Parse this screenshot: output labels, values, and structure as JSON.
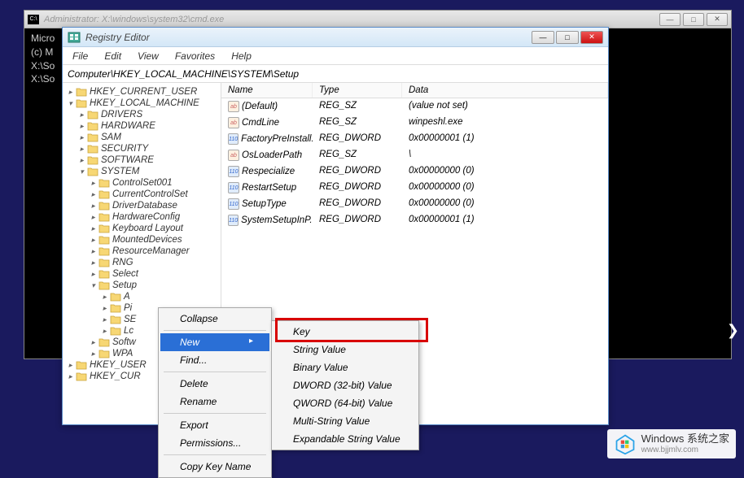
{
  "cmd": {
    "title": "Administrator: X:\\windows\\system32\\cmd.exe",
    "lines": [
      "Micro",
      "(c) M",
      "",
      "X:\\So",
      "",
      "X:\\So"
    ]
  },
  "regedit": {
    "title": "Registry Editor",
    "menus": [
      "File",
      "Edit",
      "View",
      "Favorites",
      "Help"
    ],
    "address": "Computer\\HKEY_LOCAL_MACHINE\\SYSTEM\\Setup",
    "tree": {
      "HKCU": "HKEY_CURRENT_USER",
      "HKLM": "HKEY_LOCAL_MACHINE",
      "hklm_children": [
        "DRIVERS",
        "HARDWARE",
        "SAM",
        "SECURITY",
        "SOFTWARE",
        "SYSTEM"
      ],
      "system_children": [
        "ControlSet001",
        "CurrentControlSet",
        "DriverDatabase",
        "HardwareConfig",
        "Keyboard Layout",
        "MountedDevices",
        "ResourceManager",
        "RNG",
        "Select",
        "Setup",
        "Softw",
        "WPA"
      ],
      "setup_children": [
        "A",
        "Pi",
        "SE",
        "Lc"
      ],
      "HKU": "HKEY_USER",
      "HKCR": "HKEY_CUR"
    },
    "columns": {
      "name": "Name",
      "type": "Type",
      "data": "Data"
    },
    "values": [
      {
        "icon": "sz",
        "name": "(Default)",
        "type": "REG_SZ",
        "data": "(value not set)"
      },
      {
        "icon": "sz",
        "name": "CmdLine",
        "type": "REG_SZ",
        "data": "winpeshl.exe"
      },
      {
        "icon": "dw",
        "name": "FactoryPreInstall...",
        "type": "REG_DWORD",
        "data": "0x00000001 (1)"
      },
      {
        "icon": "sz",
        "name": "OsLoaderPath",
        "type": "REG_SZ",
        "data": "\\"
      },
      {
        "icon": "dw",
        "name": "Respecialize",
        "type": "REG_DWORD",
        "data": "0x00000000 (0)"
      },
      {
        "icon": "dw",
        "name": "RestartSetup",
        "type": "REG_DWORD",
        "data": "0x00000000 (0)"
      },
      {
        "icon": "dw",
        "name": "SetupType",
        "type": "REG_DWORD",
        "data": "0x00000000 (0)"
      },
      {
        "icon": "dw",
        "name": "SystemSetupInP...",
        "type": "REG_DWORD",
        "data": "0x00000001 (1)"
      }
    ]
  },
  "context_menu": {
    "items": {
      "collapse": "Collapse",
      "new": "New",
      "find": "Find...",
      "delete": "Delete",
      "rename": "Rename",
      "export": "Export",
      "permissions": "Permissions...",
      "copy": "Copy Key Name"
    }
  },
  "submenu": {
    "items": {
      "key": "Key",
      "string": "String Value",
      "binary": "Binary Value",
      "dword": "DWORD (32-bit) Value",
      "qword": "QWORD (64-bit) Value",
      "multi": "Multi-String Value",
      "expand": "Expandable String Value"
    }
  },
  "watermark": {
    "title": "Windows 系统之家",
    "url": "www.bjjmlv.com"
  }
}
